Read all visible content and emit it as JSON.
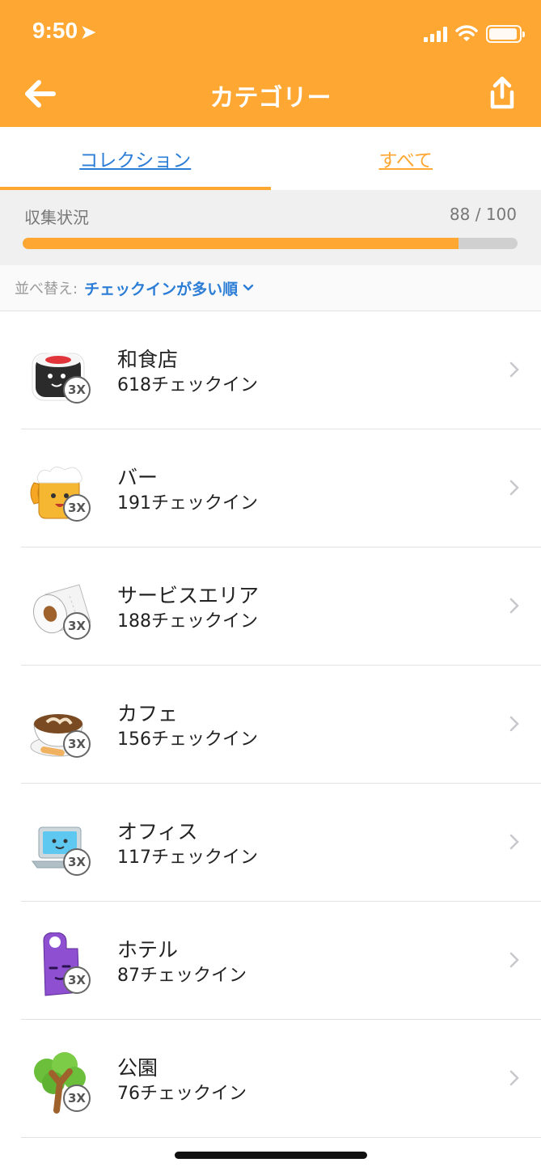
{
  "status_bar": {
    "time": "9:50",
    "location_arrow": "location-arrow-icon"
  },
  "header": {
    "title": "カテゴリー",
    "back_icon": "arrow-left-icon",
    "share_icon": "share-icon"
  },
  "tabs": [
    {
      "label": "コレクション",
      "active": true
    },
    {
      "label": "すべて",
      "active": false
    }
  ],
  "progress": {
    "label": "収集状況",
    "count": "88 / 100",
    "fraction": 0.88
  },
  "sort": {
    "label": "並べ替え:",
    "value": "チェックインが多い順"
  },
  "items": [
    {
      "name": "和食店",
      "count": "618チェックイン",
      "badge": "3X",
      "icon": "sushi-icon"
    },
    {
      "name": "バー",
      "count": "191チェックイン",
      "badge": "3X",
      "icon": "beer-mug-icon"
    },
    {
      "name": "サービスエリア",
      "count": "188チェックイン",
      "badge": "3X",
      "icon": "toilet-paper-icon"
    },
    {
      "name": "カフェ",
      "count": "156チェックイン",
      "badge": "3X",
      "icon": "coffee-cup-icon"
    },
    {
      "name": "オフィス",
      "count": "117チェックイン",
      "badge": "3X",
      "icon": "laptop-icon"
    },
    {
      "name": "ホテル",
      "count": "87チェックイン",
      "badge": "3X",
      "icon": "door-hanger-icon"
    },
    {
      "name": "公園",
      "count": "76チェックイン",
      "badge": "3X",
      "icon": "tree-icon"
    }
  ],
  "colors": {
    "accent": "#ffa733",
    "link": "#2b7dd6",
    "background_gray": "#f0f0f0"
  }
}
